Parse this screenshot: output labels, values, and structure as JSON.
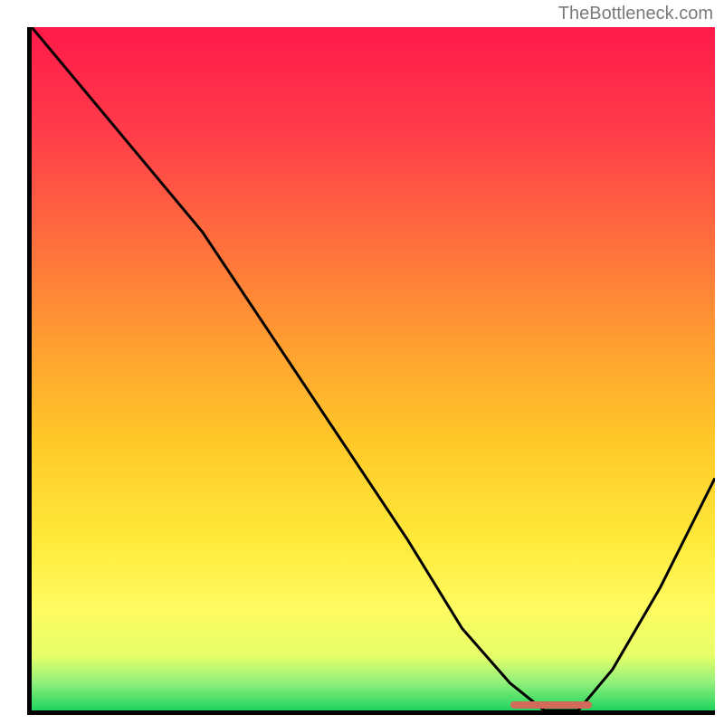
{
  "watermark": "TheBottleneck.com",
  "chart_data": {
    "type": "line",
    "title": "",
    "xlabel": "",
    "ylabel": "",
    "xlim": [
      0,
      100
    ],
    "ylim": [
      0,
      100
    ],
    "x": [
      0,
      15,
      25,
      35,
      45,
      55,
      63,
      70,
      75,
      80,
      85,
      92,
      100
    ],
    "values": [
      100,
      82,
      70,
      55,
      40,
      25,
      12,
      4,
      0,
      0,
      6,
      18,
      34
    ],
    "annotations": [],
    "gradient_stops": [
      {
        "pos": 0.0,
        "color": "#ff1a4a"
      },
      {
        "pos": 0.15,
        "color": "#ff3b4a"
      },
      {
        "pos": 0.3,
        "color": "#ff6a3e"
      },
      {
        "pos": 0.45,
        "color": "#ff9a32"
      },
      {
        "pos": 0.6,
        "color": "#ffc728"
      },
      {
        "pos": 0.75,
        "color": "#ffe93a"
      },
      {
        "pos": 0.85,
        "color": "#fffb60"
      },
      {
        "pos": 0.92,
        "color": "#e6ff6a"
      },
      {
        "pos": 0.96,
        "color": "#8ff07a"
      },
      {
        "pos": 1.0,
        "color": "#1fd45e"
      }
    ],
    "optimal_marker": {
      "x_start": 70,
      "x_end": 82,
      "y": 0
    }
  }
}
